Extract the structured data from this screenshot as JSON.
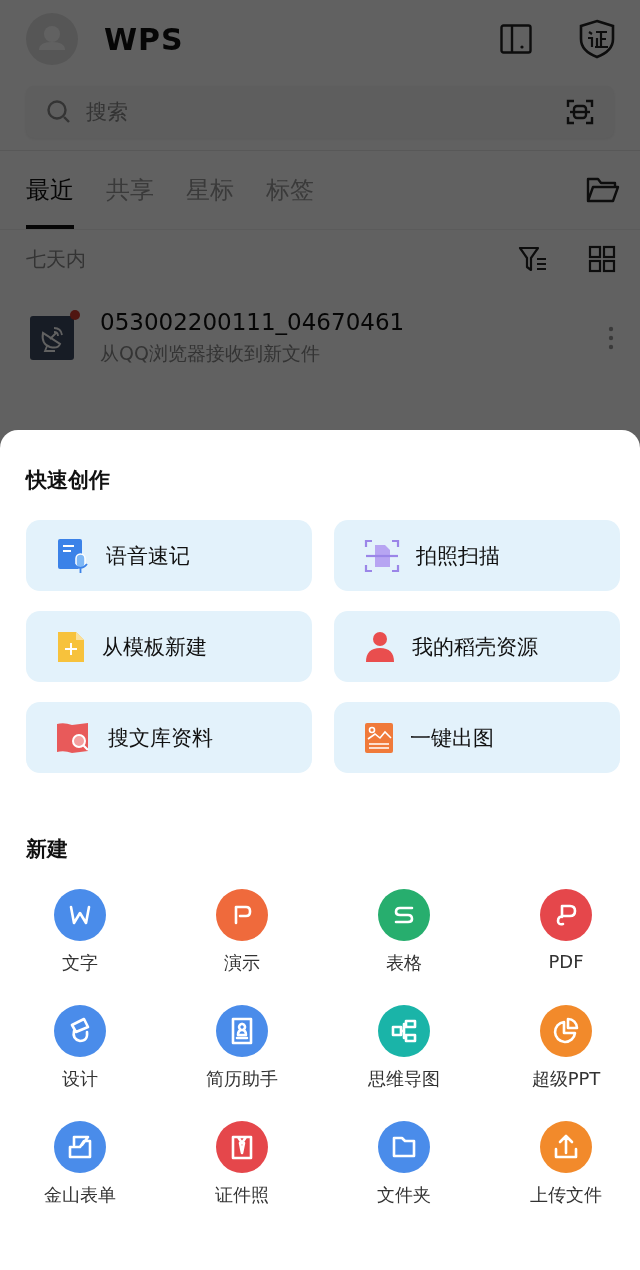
{
  "header": {
    "logo": "WPS"
  },
  "search": {
    "placeholder": "搜索"
  },
  "tabs": [
    {
      "label": "最近",
      "selected": true
    },
    {
      "label": "共享",
      "selected": false
    },
    {
      "label": "星标",
      "selected": false
    },
    {
      "label": "标签",
      "selected": false
    }
  ],
  "section": {
    "title": "七天内"
  },
  "files": [
    {
      "name": "053002200111_04670461",
      "subtitle": "从QQ浏览器接收到新文件",
      "unread": true
    }
  ],
  "sheet": {
    "quick_title": "快速创作",
    "quick": [
      {
        "label": "语音速记"
      },
      {
        "label": "拍照扫描"
      },
      {
        "label": "从模板新建"
      },
      {
        "label": "我的稻壳资源"
      },
      {
        "label": "搜文库资料"
      },
      {
        "label": "一键出图"
      }
    ],
    "new_title": "新建",
    "new": [
      {
        "label": "文字",
        "color": "#4a8cea"
      },
      {
        "label": "演示",
        "color": "#ef6a3c"
      },
      {
        "label": "表格",
        "color": "#27ae6e"
      },
      {
        "label": "PDF",
        "color": "#e5474b"
      },
      {
        "label": "设计",
        "color": "#4a8cea"
      },
      {
        "label": "简历助手",
        "color": "#4a8cea"
      },
      {
        "label": "思维导图",
        "color": "#1ab4a8"
      },
      {
        "label": "超级PPT",
        "color": "#f28a2b"
      },
      {
        "label": "金山表单",
        "color": "#4a8cea"
      },
      {
        "label": "证件照",
        "color": "#e5474b"
      },
      {
        "label": "文件夹",
        "color": "#4a8cea"
      },
      {
        "label": "上传文件",
        "color": "#f28a2b"
      }
    ]
  }
}
